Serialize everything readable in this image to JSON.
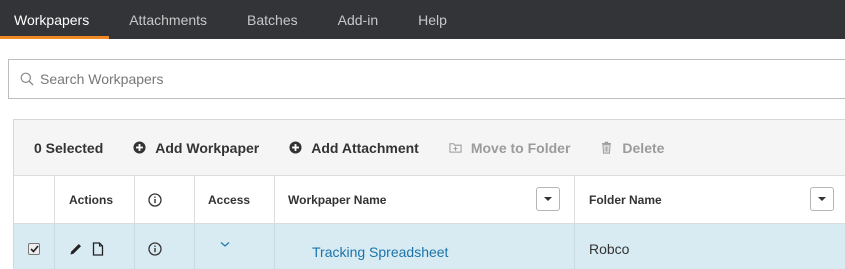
{
  "nav": {
    "tabs": [
      {
        "label": "Workpapers",
        "active": true
      },
      {
        "label": "Attachments",
        "active": false
      },
      {
        "label": "Batches",
        "active": false
      },
      {
        "label": "Add-in",
        "active": false
      },
      {
        "label": "Help",
        "active": false
      }
    ],
    "accent": "#f08a24",
    "background": "#333438"
  },
  "search": {
    "placeholder": "Search Workpapers",
    "icon": "search-icon"
  },
  "toolbar": {
    "selected_label": "0 Selected",
    "add_workpaper": "Add Workpaper",
    "add_attachment": "Add Attachment",
    "move_to_folder": "Move to Folder",
    "delete": "Delete"
  },
  "table": {
    "headers": {
      "actions": "Actions",
      "access": "Access",
      "workpaper_name": "Workpaper Name",
      "folder_name": "Folder Name"
    },
    "rows": [
      {
        "checked": true,
        "workpaper_name": "Tracking Spreadsheet",
        "folder_name": "Robco"
      }
    ],
    "row_highlight": "#d8ebf3",
    "link_color": "#1b74a8"
  }
}
